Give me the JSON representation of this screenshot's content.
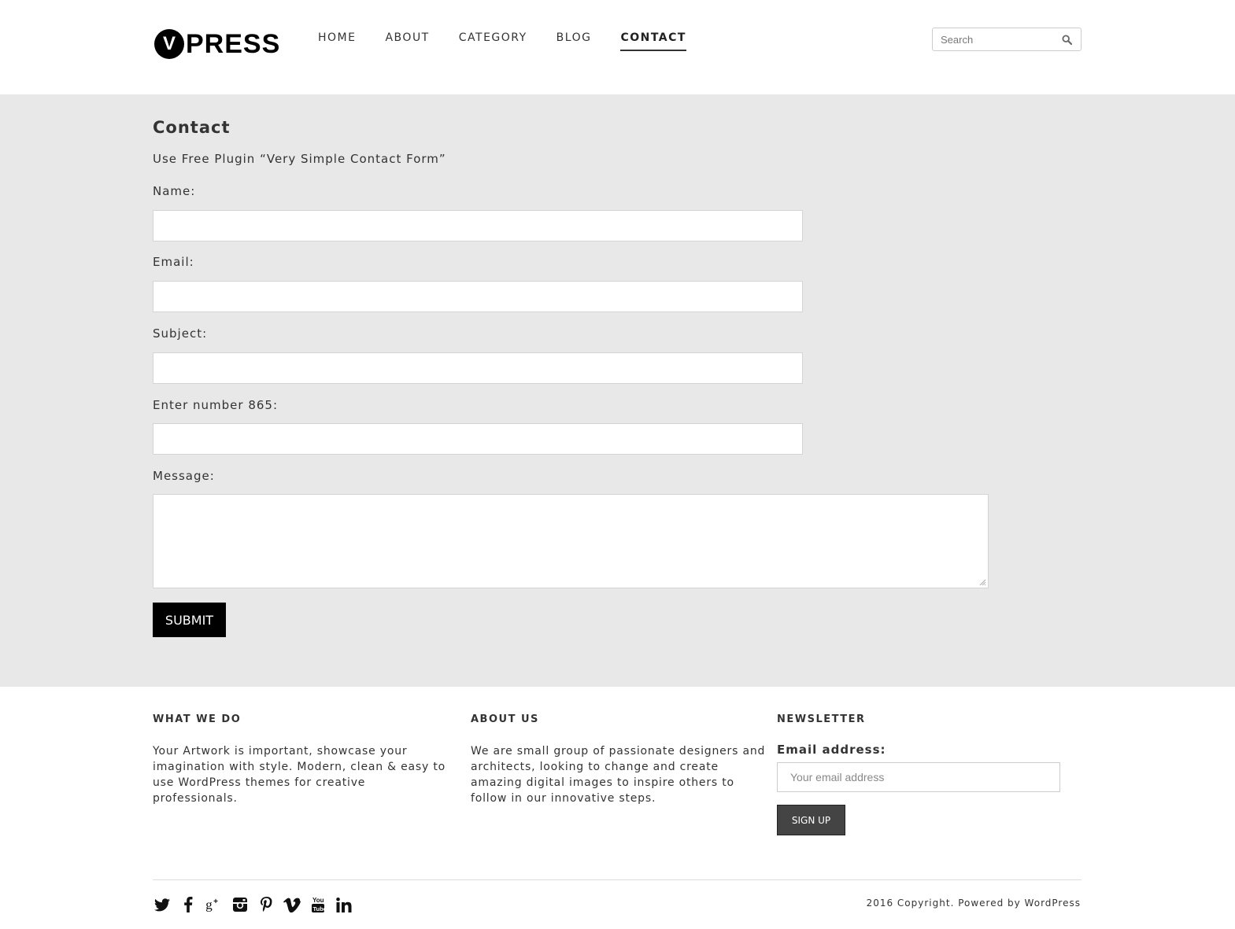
{
  "brand": {
    "logo_letter": "V",
    "logo_word": "PRESS"
  },
  "nav": {
    "items": [
      {
        "label": "HOME"
      },
      {
        "label": "ABOUT"
      },
      {
        "label": "CATEGORY"
      },
      {
        "label": "BLOG"
      },
      {
        "label": "CONTACT",
        "active": true
      }
    ]
  },
  "search": {
    "placeholder": "Search",
    "icon": "search-icon"
  },
  "contact": {
    "title": "Contact",
    "intro": "Use Free Plugin “Very Simple Contact Form”",
    "fields": {
      "name_label": "Name:",
      "email_label": "Email:",
      "subject_label": "Subject:",
      "number_label": "Enter number 865:",
      "message_label": "Message:"
    },
    "values": {
      "name": "",
      "email": "",
      "subject": "",
      "number": "",
      "message": ""
    },
    "submit_label": "SUBMIT"
  },
  "footer": {
    "what_we_do": {
      "heading": "WHAT WE DO",
      "text_lines": [
        "Your Artwork is important, showcase your",
        "imagination with style. Modern, clean & easy to",
        "use WordPress themes for creative",
        "professionals."
      ]
    },
    "about_us": {
      "heading": "ABOUT US",
      "text_lines": [
        "We are small group of passionate designers and",
        "architects, looking to change and create",
        "amazing digital images to inspire others to",
        "follow in our innovative steps."
      ]
    },
    "newsletter": {
      "heading": "NEWSLETTER",
      "email_label": "Email address:",
      "email_placeholder": "Your email address",
      "signup_label": "SIGN UP"
    },
    "socials": [
      "twitter-icon",
      "facebook-icon",
      "google-plus-icon",
      "instagram-icon",
      "pinterest-icon",
      "vimeo-icon",
      "youtube-icon",
      "linkedin-icon"
    ],
    "copyright": "2016 Copyright. Powered by WordPress"
  },
  "colors": {
    "main_bg": "#e8e8e8",
    "button_black": "#000000",
    "signup_bg": "#444444"
  }
}
